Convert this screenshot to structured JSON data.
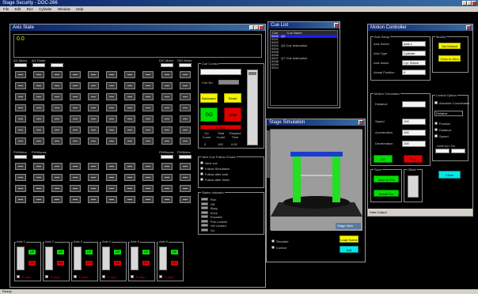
{
  "app": {
    "title": "Stage Security - DOC-266",
    "menu": [
      "File",
      "Edit",
      "Run",
      "Cylinder",
      "Window",
      "Help"
    ]
  },
  "main_window": {
    "title": "Axis State",
    "display_text": "0.0"
  },
  "fader_section": {
    "top_labels": [
      "A/L Motor",
      "A/L Fader",
      "D/C Motor",
      "O/D Motor"
    ],
    "bottom_labels": [
      "PH/Motor",
      "PH/Mouse",
      "PH/Mouse",
      "PH/Motor"
    ]
  },
  "cue_control": {
    "group_label": "Cue Control",
    "cue_no_label": "Cue No",
    "buttons": {
      "backward": "Backward",
      "reset": "Reset",
      "go": "GO",
      "stop": "Stop",
      "estop": "E-Stop"
    },
    "readouts": {
      "labels": [
        "Go Count",
        "Total Count",
        "Elapsed Time"
      ],
      "values": [
        "0",
        "100",
        "0:00"
      ]
    }
  },
  "next_cue": {
    "group_label": "Next Cue Follow Choice",
    "options": [
      "Next cue",
      "Follow Simulation",
      "Follow after wait",
      "Follow after finish"
    ]
  },
  "status_group": {
    "group_label": "Status Indicator",
    "items": [
      "Run",
      "Off",
      "Busy",
      "Error",
      "Encoder",
      "Pos Locked",
      "Vel Locked",
      "Go"
    ]
  },
  "channels": [
    {
      "label": "Axis 1",
      "up": "UP",
      "down": "DN",
      "estop": "E-stop"
    },
    {
      "label": "Axis 2",
      "up": "UP",
      "down": "DN",
      "estop": "E-stop"
    },
    {
      "label": "Axis 3",
      "up": "UP",
      "down": "DN",
      "estop": "E-stop"
    },
    {
      "label": "Axis 4",
      "up": "UP",
      "down": "DN",
      "estop": "E-stop"
    },
    {
      "label": "Axis 5",
      "up": "UP",
      "down": "DN",
      "estop": "E-stop"
    },
    {
      "label": "Axis 6",
      "up": "UP",
      "down": "DN",
      "estop": "E-stop"
    }
  ],
  "cue_list": {
    "title": "Cue List",
    "columns": [
      "Cue",
      "Cue Name"
    ],
    "rows": [
      {
        "cue": "0000",
        "name": "Q0",
        "selected": true
      },
      {
        "cue": "0001",
        "name": "",
        "selected": false
      },
      {
        "cue": "0002",
        "name": "",
        "selected": false
      },
      {
        "cue": "0003",
        "name": "Q3 Cue Instruction",
        "selected": false
      },
      {
        "cue": "0004",
        "name": "",
        "selected": false
      },
      {
        "cue": "0005",
        "name": "",
        "selected": false
      },
      {
        "cue": "0006",
        "name": "",
        "selected": false
      },
      {
        "cue": "0007",
        "name": "Q7 Cue Instruction",
        "selected": false
      },
      {
        "cue": "0008",
        "name": "",
        "selected": false
      },
      {
        "cue": "0009",
        "name": "",
        "selected": false
      },
      {
        "cue": "0010",
        "name": "",
        "selected": false
      }
    ]
  },
  "stage_window": {
    "title": "Stage Simulation",
    "display_text": "Stage View",
    "radios": [
      "Simulate",
      "Control"
    ],
    "btn_yellow": "Load Scene",
    "btn_cyan": "Exit"
  },
  "right_window": {
    "title": "Motion Controller",
    "axis_group": "Axis Setup",
    "fields": [
      {
        "label": "Axis Select",
        "value": "Axis 1"
      },
      {
        "label": "Axis Type",
        "value": "Cylinder"
      },
      {
        "label": "Axis Name",
        "value": "Cyl. Winch"
      },
      {
        "label": "Actual Position",
        "value": "0"
      }
    ],
    "modes_group": "Modes",
    "modes_buttons": [
      "Set Default",
      "Clear to Zero"
    ],
    "motion_group": "Motion Command",
    "motion_fields": [
      {
        "label": "Distance",
        "value": ""
      },
      {
        "label": "Speed",
        "value": "100"
      },
      {
        "label": "Acceleration",
        "value": "100"
      },
      {
        "label": "Deceleration",
        "value": "100"
      }
    ],
    "motion_go": "GO",
    "motion_stop": "Stop",
    "options_group": "Control Option",
    "options_check": "Absolute Coordinates",
    "options_select": "Relative",
    "options_list": [
      "Position",
      "Distance",
      "Speed"
    ],
    "limit_label": "Limit Up / Dn",
    "save_group": "Save",
    "save_buttons": [
      "Save to File",
      "Recall File"
    ],
    "offset_group": "Offset",
    "cyan_button": "Close",
    "footer": "Data Output"
  },
  "status_bar": "Ready"
}
